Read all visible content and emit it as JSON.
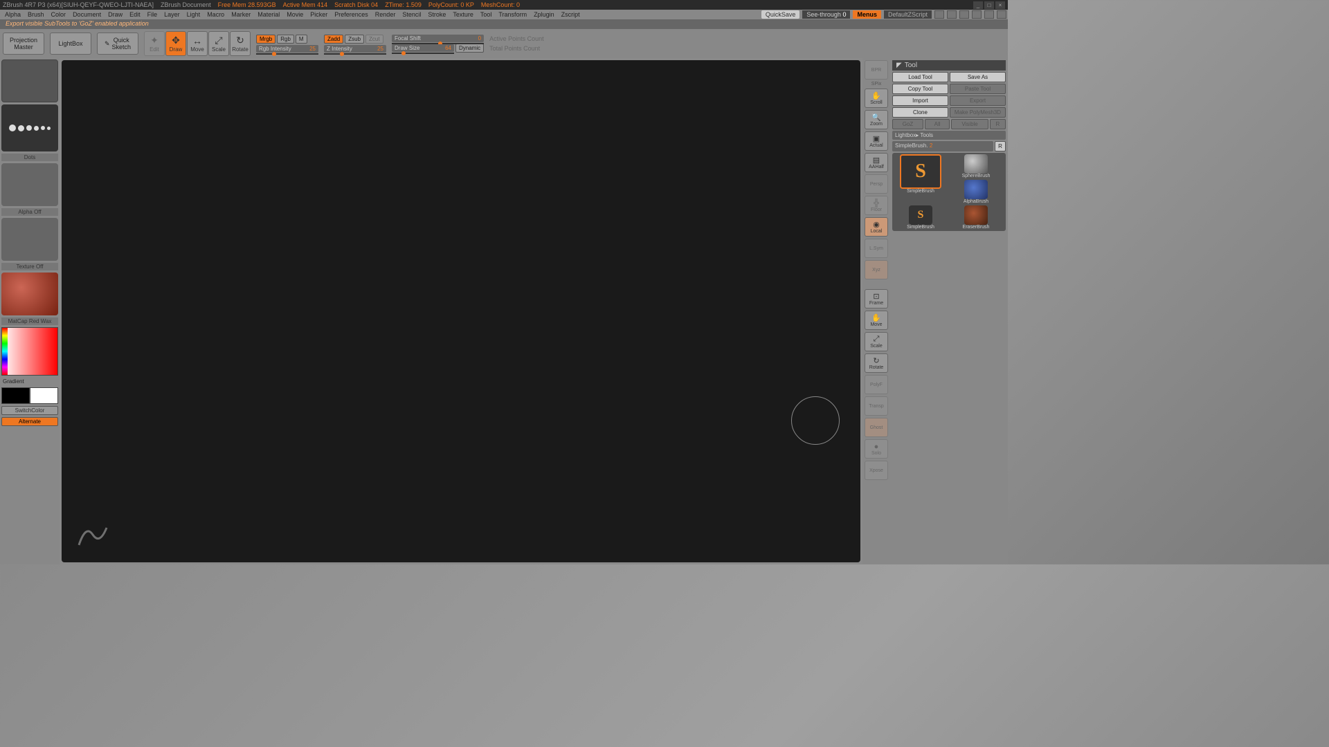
{
  "title": {
    "app": "ZBrush 4R7 P3 (x64)[SIUH-QEYF-QWEO-LJTI-NAEA]",
    "doc": "ZBrush Document",
    "freemem": "Free Mem 28.593GB",
    "activemem": "Active Mem 414",
    "scratch": "Scratch Disk 04",
    "ztime": "ZTime: 1.509",
    "polycount": "PolyCount: 0 KP",
    "meshcount": "MeshCount: 0"
  },
  "menu": {
    "items": [
      "Alpha",
      "Brush",
      "Color",
      "Document",
      "Draw",
      "Edit",
      "File",
      "Layer",
      "Light",
      "Macro",
      "Marker",
      "Material",
      "Movie",
      "Picker",
      "Preferences",
      "Render",
      "Stencil",
      "Stroke",
      "Texture",
      "Tool",
      "Transform",
      "Zplugin",
      "Zscript"
    ],
    "quicksave": "QuickSave",
    "seethrough": "See-through",
    "seethrough_val": "0",
    "menus": "Menus",
    "defaultscript": "DefaultZScript"
  },
  "status": "Export visible SubTools to 'GoZ' enabled application",
  "toolbar": {
    "projection": "Projection\nMaster",
    "lightbox": "LightBox",
    "quicksketch": "Quick\nSketch",
    "edit": "Edit",
    "draw": "Draw",
    "move": "Move",
    "scale": "Scale",
    "rotate": "Rotate",
    "mrgb": "Mrgb",
    "rgb": "Rgb",
    "m": "M",
    "rgb_intensity": "Rgb Intensity",
    "rgb_intensity_val": "25",
    "zadd": "Zadd",
    "zsub": "Zsub",
    "zcut": "Zcut",
    "z_intensity": "Z Intensity",
    "z_intensity_val": "25",
    "focal_shift": "Focal Shift",
    "focal_shift_val": "0",
    "draw_size": "Draw Size",
    "draw_size_val": "64",
    "dynamic": "Dynamic",
    "active_points": "Active Points Count",
    "total_points": "Total Points Count"
  },
  "left": {
    "dots": "Dots",
    "alpha_off": "Alpha Off",
    "texture_off": "Texture Off",
    "material": "MatCap Red Wax",
    "gradient": "Gradient",
    "switchcolor": "SwitchColor",
    "alternate": "Alternate"
  },
  "dock": {
    "bpr": "BPR",
    "spix": "SPix",
    "scroll": "Scroll",
    "zoom": "Zoom",
    "actual": "Actual",
    "aahalf": "AAHalf",
    "persp": "Persp",
    "floor": "Floor",
    "local": "Local",
    "lxyz": "L.Sym",
    "xyz": "Xyz",
    "frame": "Frame",
    "move": "Move",
    "scale": "Scale",
    "rotate": "Rotate",
    "polyf": "PolyF",
    "transp": "Transp",
    "ghost": "Ghost",
    "solo": "Solo",
    "xpose": "Xpose"
  },
  "right": {
    "tool_header": "Tool",
    "load_tool": "Load Tool",
    "save_as": "Save As",
    "copy_tool": "Copy Tool",
    "paste_tool": "Paste Tool",
    "import": "Import",
    "export": "Export",
    "clone": "Clone",
    "make_polymesh": "Make PolyMesh3D",
    "goz": "GoZ",
    "all": "All",
    "visible": "Visible",
    "r": "R",
    "lightbox_tools": "Lightbox▸ Tools",
    "simplebrush": "SimpleBrush.",
    "simplebrush_val": "2",
    "brushes": {
      "simplebrush": "SimpleBrush",
      "spherebrush": "SphereBrush",
      "alphabrush": "AlphaBrush",
      "eraserbrush": "EraserBrush"
    }
  }
}
